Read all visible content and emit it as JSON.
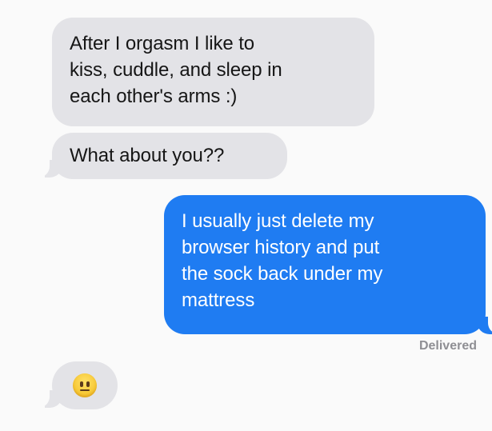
{
  "thread": {
    "messages": [
      {
        "direction": "received",
        "text": "After I orgasm I like to\nkiss, cuddle, and sleep in\neach other's arms :)"
      },
      {
        "direction": "received",
        "text": "What about you??"
      },
      {
        "direction": "sent",
        "text": "I usually just delete my\nbrowser history and put\nthe sock back under my\nmattress"
      },
      {
        "direction": "received",
        "emoji": "neutral-face"
      }
    ],
    "status": "Delivered"
  },
  "colors": {
    "received_bubble": "#e3e3e7",
    "sent_bubble": "#1f7cf2",
    "background": "#fafafa"
  }
}
